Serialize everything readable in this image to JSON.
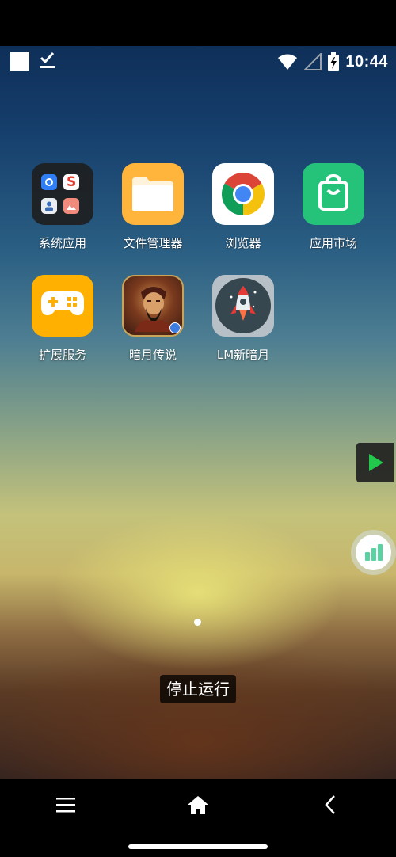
{
  "status_bar": {
    "time": "10:44",
    "icons": [
      "notification-square-icon",
      "checkbox-icon",
      "wifi-icon",
      "signal-icon",
      "battery-charging-icon"
    ]
  },
  "apps": [
    {
      "label": "系统应用",
      "icon": "folder-icon"
    },
    {
      "label": "文件管理器",
      "icon": "files-icon"
    },
    {
      "label": "浏览器",
      "icon": "chrome-icon"
    },
    {
      "label": "应用市场",
      "icon": "app-store-icon"
    },
    {
      "label": "扩展服务",
      "icon": "gamepad-icon"
    },
    {
      "label": "暗月传说",
      "icon": "game-avatar-icon"
    },
    {
      "label": "LM新暗月",
      "icon": "rocket-icon"
    }
  ],
  "overlay": {
    "stop_label": "停止运行"
  },
  "navigation": {
    "icons": [
      "menu-icon",
      "home-icon",
      "back-icon"
    ]
  },
  "colors": {
    "folder_bg": "#1e1e1e",
    "files_orange": "#ffb43c",
    "store_green": "#25c27a",
    "gamepad_orange": "#ffb000",
    "play_green": "#22c84c"
  }
}
